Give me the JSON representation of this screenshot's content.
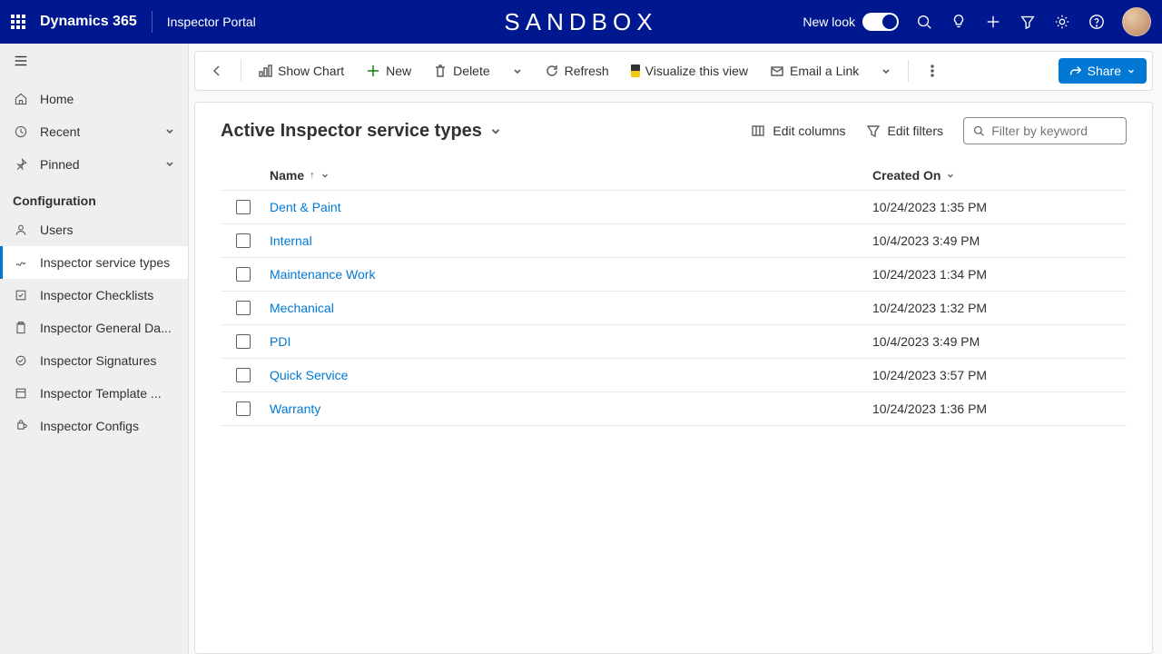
{
  "header": {
    "brand": "Dynamics 365",
    "app_name": "Inspector Portal",
    "sandbox_label": "SANDBOX",
    "new_look_label": "New look"
  },
  "sidebar": {
    "main_items": [
      {
        "label": "Home",
        "icon": "home"
      },
      {
        "label": "Recent",
        "icon": "clock",
        "expandable": true
      },
      {
        "label": "Pinned",
        "icon": "pin",
        "expandable": true
      }
    ],
    "section_label": "Configuration",
    "config_items": [
      {
        "label": "Users",
        "icon": "user"
      },
      {
        "label": "Inspector service types",
        "icon": "squiggle",
        "active": true
      },
      {
        "label": "Inspector Checklists",
        "icon": "checkbox"
      },
      {
        "label": "Inspector General Da...",
        "icon": "clipboard"
      },
      {
        "label": "Inspector Signatures",
        "icon": "signature"
      },
      {
        "label": "Inspector Template ...",
        "icon": "template"
      },
      {
        "label": "Inspector Configs",
        "icon": "puzzle"
      }
    ]
  },
  "commandbar": {
    "show_chart": "Show Chart",
    "new": "New",
    "delete": "Delete",
    "refresh": "Refresh",
    "visualize": "Visualize this view",
    "email": "Email a Link",
    "share": "Share"
  },
  "view": {
    "title": "Active Inspector service types",
    "edit_columns": "Edit columns",
    "edit_filters": "Edit filters",
    "filter_placeholder": "Filter by keyword"
  },
  "grid": {
    "columns": {
      "name": "Name",
      "created": "Created On"
    },
    "rows": [
      {
        "name": "Dent & Paint",
        "created": "10/24/2023 1:35 PM"
      },
      {
        "name": "Internal",
        "created": "10/4/2023 3:49 PM"
      },
      {
        "name": "Maintenance Work",
        "created": "10/24/2023 1:34 PM"
      },
      {
        "name": "Mechanical",
        "created": "10/24/2023 1:32 PM"
      },
      {
        "name": "PDI",
        "created": "10/4/2023 3:49 PM"
      },
      {
        "name": "Quick Service",
        "created": "10/24/2023 3:57 PM"
      },
      {
        "name": "Warranty",
        "created": "10/24/2023 1:36 PM"
      }
    ]
  }
}
